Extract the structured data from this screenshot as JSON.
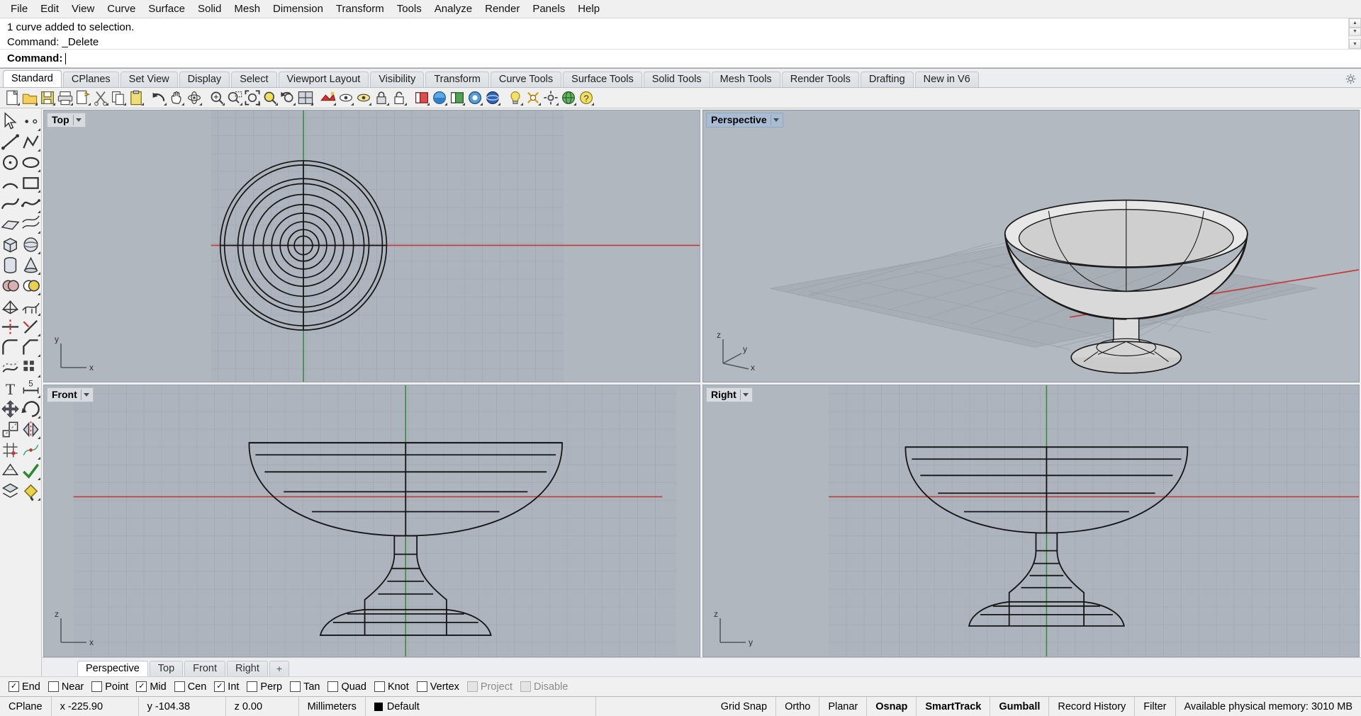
{
  "menubar": {
    "items": [
      {
        "label": "File"
      },
      {
        "label": "Edit"
      },
      {
        "label": "View"
      },
      {
        "label": "Curve"
      },
      {
        "label": "Surface"
      },
      {
        "label": "Solid"
      },
      {
        "label": "Mesh"
      },
      {
        "label": "Dimension"
      },
      {
        "label": "Transform"
      },
      {
        "label": "Tools"
      },
      {
        "label": "Analyze"
      },
      {
        "label": "Render"
      },
      {
        "label": "Panels"
      },
      {
        "label": "Help"
      }
    ]
  },
  "command_area": {
    "history": [
      "1 curve added to selection.",
      "Command: _Delete"
    ],
    "prompt_label": "Command:",
    "prompt_value": ""
  },
  "tabs": {
    "items": [
      {
        "label": "Standard",
        "active": true
      },
      {
        "label": "CPlanes",
        "active": false
      },
      {
        "label": "Set View",
        "active": false
      },
      {
        "label": "Display",
        "active": false
      },
      {
        "label": "Select",
        "active": false
      },
      {
        "label": "Viewport Layout",
        "active": false
      },
      {
        "label": "Visibility",
        "active": false
      },
      {
        "label": "Transform",
        "active": false
      },
      {
        "label": "Curve Tools",
        "active": false
      },
      {
        "label": "Surface Tools",
        "active": false
      },
      {
        "label": "Solid Tools",
        "active": false
      },
      {
        "label": "Mesh Tools",
        "active": false
      },
      {
        "label": "Render Tools",
        "active": false
      },
      {
        "label": "Drafting",
        "active": false
      },
      {
        "label": "New in V6",
        "active": false
      }
    ]
  },
  "toolbar": {
    "icons": [
      "new-file-icon",
      "open-folder-icon",
      "save-icon",
      "print-icon",
      "save-as-icon",
      "cut-scissors-icon",
      "copy-icon",
      "paste-icon",
      "undo-icon",
      "pan-hand-icon",
      "rotate-view-icon",
      "zoom-in-icon",
      "zoom-window-icon",
      "zoom-extents-icon",
      "zoom-selected-icon",
      "zoom-previous-icon",
      "viewport-layout-icon",
      "render-icon",
      "hide-objects-icon",
      "show-objects-icon",
      "lock-objects-icon",
      "unlock-objects-icon",
      "layer-icon",
      "layer-on-icon",
      "layer-group-icon",
      "layer-color-icon",
      "layer-sphere-icon",
      "light-bulb-icon",
      "properties-icon",
      "grid-settings-icon",
      "globe-icon",
      "help-icon"
    ]
  },
  "left_tools": {
    "icons": [
      "select-arrow-icon",
      "select-point-icon",
      "line-icon",
      "polyline-icon",
      "circle-icon",
      "ellipse-icon",
      "arc-icon",
      "rectangle-icon",
      "curve-icon",
      "freeform-curve-icon",
      "surface-plane-icon",
      "surface-loft-icon",
      "box-icon",
      "sphere-icon",
      "cylinder-icon",
      "cone-icon",
      "boolean-union-icon",
      "boolean-diff-icon",
      "mesh-icon",
      "mesh-from-surface-icon",
      "trim-icon",
      "split-icon",
      "fillet-icon",
      "chamfer-icon",
      "offset-icon",
      "array-icon",
      "text-icon",
      "dimension-icon",
      "move-icon",
      "rotate-icon",
      "scale-icon",
      "mirror-icon",
      "grid-snap-icon",
      "analysis-icon",
      "render-mesh-icon",
      "check-icon",
      "blocks-icon",
      "paint-bucket-icon"
    ]
  },
  "viewports": [
    {
      "name": "Top",
      "active": false,
      "axes": [
        "y",
        "x"
      ]
    },
    {
      "name": "Perspective",
      "active": true,
      "axes": [
        "z",
        "y",
        "x"
      ]
    },
    {
      "name": "Front",
      "active": false,
      "axes": [
        "z",
        "x"
      ]
    },
    {
      "name": "Right",
      "active": false,
      "axes": [
        "z",
        "y"
      ]
    }
  ],
  "viewport_tabs": {
    "items": [
      {
        "label": "Perspective",
        "active": true
      },
      {
        "label": "Top",
        "active": false
      },
      {
        "label": "Front",
        "active": false
      },
      {
        "label": "Right",
        "active": false
      }
    ],
    "add_label": "+"
  },
  "osnap": {
    "items": [
      {
        "label": "End",
        "checked": true,
        "disabled": false
      },
      {
        "label": "Near",
        "checked": false,
        "disabled": false
      },
      {
        "label": "Point",
        "checked": false,
        "disabled": false
      },
      {
        "label": "Mid",
        "checked": true,
        "disabled": false
      },
      {
        "label": "Cen",
        "checked": false,
        "disabled": false
      },
      {
        "label": "Int",
        "checked": true,
        "disabled": false
      },
      {
        "label": "Perp",
        "checked": false,
        "disabled": false
      },
      {
        "label": "Tan",
        "checked": false,
        "disabled": false
      },
      {
        "label": "Quad",
        "checked": false,
        "disabled": false
      },
      {
        "label": "Knot",
        "checked": false,
        "disabled": false
      },
      {
        "label": "Vertex",
        "checked": false,
        "disabled": false
      },
      {
        "label": "Project",
        "checked": false,
        "disabled": true
      },
      {
        "label": "Disable",
        "checked": false,
        "disabled": true
      }
    ]
  },
  "statusbar": {
    "cplane": "CPlane",
    "x": "x -225.90",
    "y": "y -104.38",
    "z": "z 0.00",
    "units": "Millimeters",
    "layer": "Default",
    "layer_color": "#000000",
    "toggles": [
      {
        "label": "Grid Snap",
        "on": false
      },
      {
        "label": "Ortho",
        "on": false
      },
      {
        "label": "Planar",
        "on": false
      },
      {
        "label": "Osnap",
        "on": true
      },
      {
        "label": "SmartTrack",
        "on": true
      },
      {
        "label": "Gumball",
        "on": true
      },
      {
        "label": "Record History",
        "on": false
      },
      {
        "label": "Filter",
        "on": false
      }
    ],
    "memory": "Available physical memory: 3010 MB"
  },
  "colors": {
    "viewport_bg": "#b0b7bf",
    "grid_line": "#a3abb4",
    "grid_major": "#98a0a9",
    "x_axis": "#cc3333",
    "y_axis": "#2a9a2a",
    "model_line": "#1a1a1a",
    "active_vp_label": "#a8bdd4"
  }
}
